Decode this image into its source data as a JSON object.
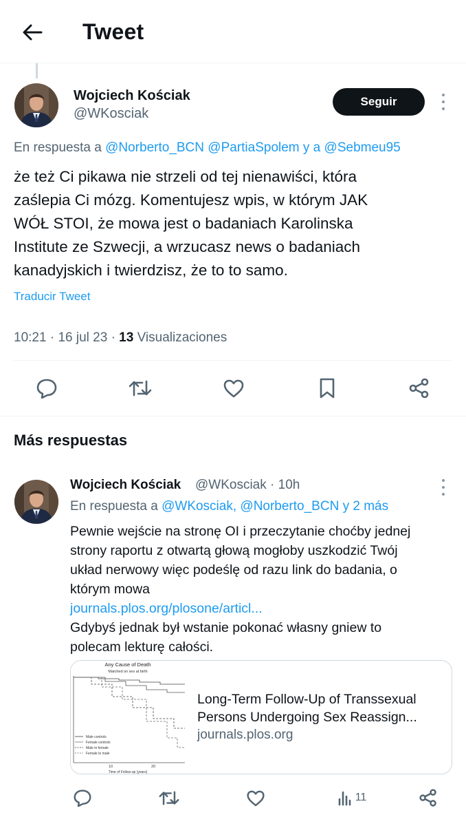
{
  "header": {
    "title": "Tweet",
    "back_icon": "arrow-left-icon"
  },
  "main_tweet": {
    "author_name": "Wojciech Kościak",
    "author_handle": "@WKosciak",
    "follow_label": "Seguir",
    "reply_prefix": "En respuesta a",
    "reply_mention_1": "@Norberto_BCN",
    "reply_mention_2": "@PartiaSpolem",
    "reply_joiner": "y a",
    "reply_mention_3": "@Sebmeu95",
    "text_lines": [
      "że też Ci pikawa nie strzeli od tej nienawiści, która",
      "zaślepia Ci mózg. Komentujesz wpis, w którym JAK",
      "WÓŁ STOI, że mowa jest o badaniach Karolinska",
      "Institute ze Szwecji, a wrzucasz news o badaniach",
      "kanadyjskich i twierdzisz, że to to samo."
    ],
    "translate_label": "Traducir Tweet",
    "time": "10:21",
    "date": "16 jul 23",
    "views_count": "13",
    "views_label": "Visualizaciones",
    "actions": [
      "reply-icon",
      "retweet-icon",
      "like-icon",
      "bookmark-icon",
      "share-icon"
    ]
  },
  "more_replies": {
    "heading": "Más respuestas"
  },
  "reply": {
    "author_name": "Wojciech Kościak",
    "author_handle": "@WKosciak",
    "separator": "·",
    "time": "10h",
    "reply_prefix": "En respuesta a",
    "reply_mentions": "@WKosciak, @Norberto_BCN",
    "reply_more": "y 2 más",
    "text_lines": [
      "Pewnie wejście na stronę OI i przeczytanie choćby jednej",
      "strony raportu z otwartą głową mogłoby uszkodzić Twój",
      "układ nerwowy więc podeślę od razu link do badania, o",
      "którym mowa"
    ],
    "link": "journals.plos.org/plosone/articl...",
    "text_after_lines": [
      "Gdybyś jednak był wstanie pokonać własny gniew to",
      "polecam lekturę całości."
    ],
    "card": {
      "thumb_title": "Any Cause of Death",
      "thumb_subtitle": "Matched on sex at birth",
      "thumb_legend": [
        "Male controls",
        "Female controls",
        "Male to female",
        "Female to male"
      ],
      "thumb_ticks": [
        "10",
        "20"
      ],
      "thumb_xlabel": "Time of Follow-up (years)",
      "title_line_1": "Long-Term Follow-Up of Transsexual",
      "title_line_2": "Persons Undergoing Sex Reassign...",
      "domain": "journals.plos.org"
    },
    "views_count": "11",
    "actions": [
      "reply-icon",
      "retweet-icon",
      "like-icon",
      "views-icon",
      "share-icon"
    ]
  },
  "colors": {
    "accent": "#1d9bf0",
    "text": "#0f1419",
    "secondary": "#536471",
    "border": "#eff3f4"
  }
}
